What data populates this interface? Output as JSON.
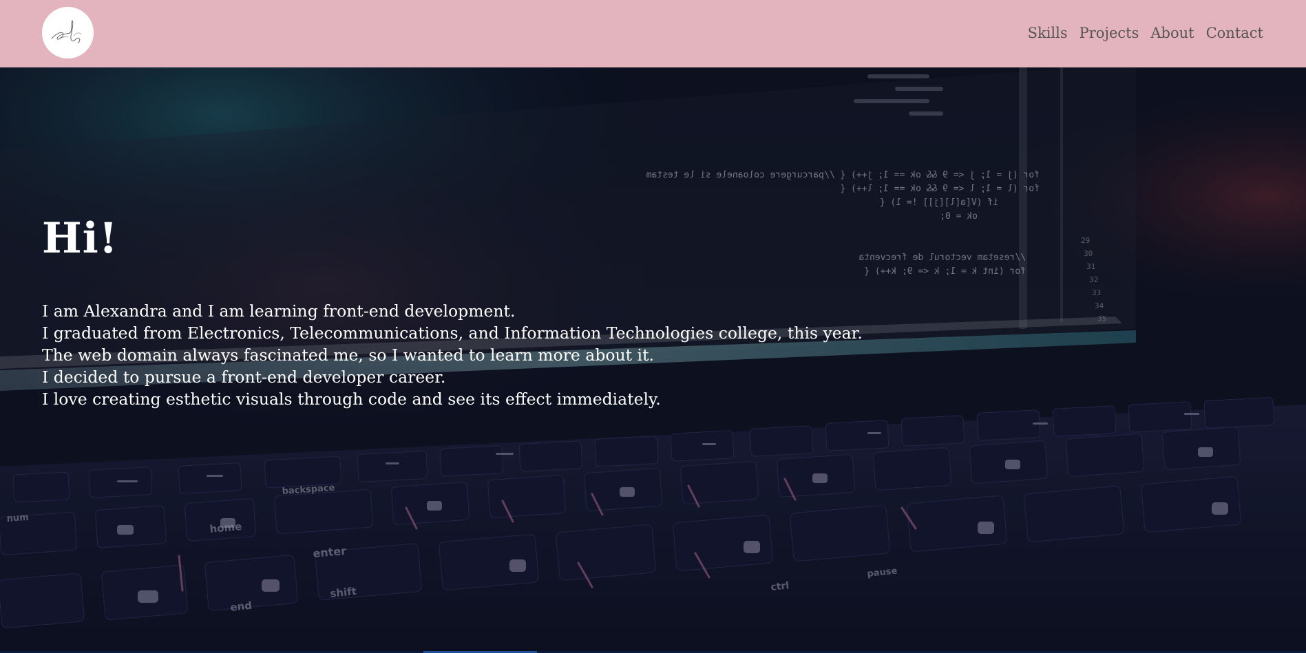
{
  "header": {
    "background": "#e4b4be",
    "logo": {
      "icon": "signature-logo-icon"
    },
    "nav": [
      {
        "label": "Skills"
      },
      {
        "label": "Projects"
      },
      {
        "label": "About"
      },
      {
        "label": "Contact"
      }
    ]
  },
  "hero": {
    "title": "Hi!",
    "lines": [
      "I am Alexandra and I am learning front-end development.",
      "I graduated from Electronics, Telecommunications, and Information Technologies college, this year.",
      "The web domain always fascinated me, so I wanted to learn more about it.",
      "I decided to pursue a front-end developer career.",
      "I love creating esthetic visuals through code and see its effect immediately."
    ],
    "background_image": "laptop-code-keyboard-photo",
    "screen_code_lines": [
      "for (j = 1; j <= 9 && ok == 1; j++)   {   //parcurgere coloanele si le testam",
      "for (l = 1; l <= 9 && ok == 1; l++) {",
      "if (V[a[l][j]] != 1) {",
      "ok = 0;",
      "//resetam vectorul de frecventa",
      "for (int k = 1; k <= 9; k++) {"
    ],
    "screen_line_numbers": [
      "29",
      "30",
      "31",
      "32",
      "33",
      "34",
      "35"
    ],
    "keyboard_labels": [
      "home",
      "end",
      "enter",
      "backspace",
      "shift",
      "ctrl",
      "num",
      "pause"
    ]
  }
}
